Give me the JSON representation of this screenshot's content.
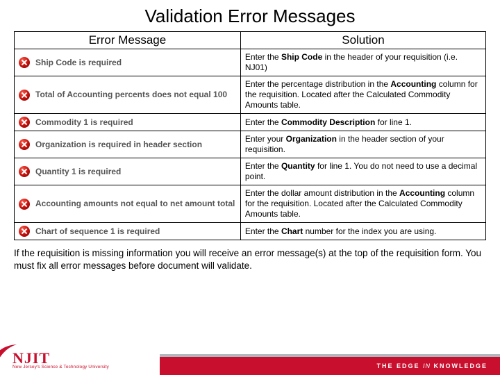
{
  "title": "Validation Error Messages",
  "headers": {
    "error": "Error Message",
    "solution": "Solution"
  },
  "rows": [
    {
      "error": "Ship Code is required",
      "solution_pre": "Enter the ",
      "solution_bold": "Ship Code",
      "solution_post": " in the header of your requisition (i.e. NJ01)"
    },
    {
      "error": "Total of Accounting percents does not equal 100",
      "solution_pre": "Enter the percentage distribution in the ",
      "solution_bold": "Accounting",
      "solution_post": " column for the requisition.  Located after the Calculated Commodity Amounts table."
    },
    {
      "error": "Commodity 1 is required",
      "solution_pre": "Enter the ",
      "solution_bold": "Commodity Description",
      "solution_post": " for line 1."
    },
    {
      "error": "Organization is required in header section",
      "solution_pre": "Enter your ",
      "solution_bold": "Organization",
      "solution_post": " in the header section of your requisition."
    },
    {
      "error": "Quantity 1 is required",
      "solution_pre": "Enter the ",
      "solution_bold": "Quantity",
      "solution_post": " for line 1.  You do not need to use a decimal point."
    },
    {
      "error": "Accounting amounts not equal to net amount total",
      "solution_pre": "Enter the dollar amount distribution in the ",
      "solution_bold": "Accounting",
      "solution_post": " column for the requisition.  Located after the Calculated Commodity Amounts table."
    },
    {
      "error": "Chart of sequence 1 is required",
      "solution_pre": "Enter the ",
      "solution_bold": "Chart",
      "solution_post": " number for the index you are using."
    }
  ],
  "note": "If the requisition is missing information you will receive an error message(s) at the top of the requisition form.  You must fix all error messages before document will validate.",
  "footer": {
    "logo_main": "NJIT",
    "logo_sub": "New Jersey's Science & Technology University",
    "tagline_pre": "THE EDGE ",
    "tagline_italic": "IN",
    "tagline_post": " KNOWLEDGE"
  }
}
